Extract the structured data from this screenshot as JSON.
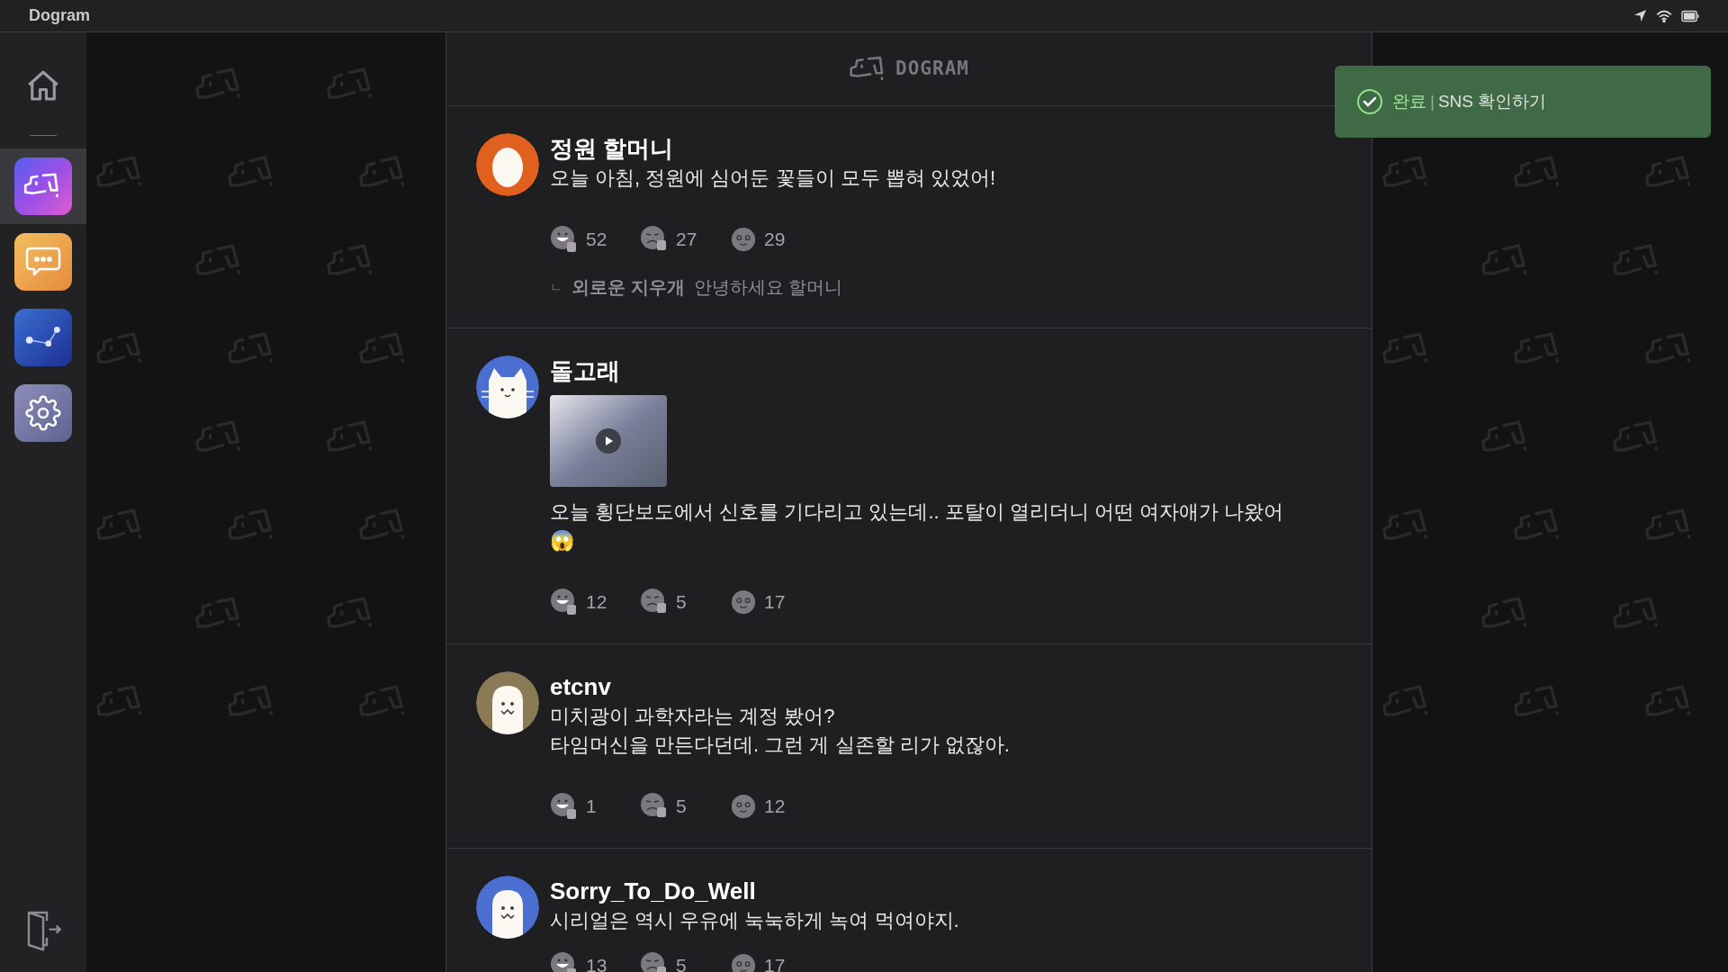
{
  "app_bar": {
    "title": "Dogram"
  },
  "sidebar": {
    "items": [
      {
        "kind": "home",
        "selected": false
      },
      {
        "kind": "dog",
        "selected": true
      },
      {
        "kind": "chat",
        "selected": false
      },
      {
        "kind": "graph",
        "selected": false
      },
      {
        "kind": "settings",
        "selected": false
      }
    ]
  },
  "feed": {
    "header": {
      "logo_text": "DOGRAM"
    },
    "posts": [
      {
        "author": "정원 할머니",
        "avatar": {
          "kind": "egg",
          "color": "#e0601f"
        },
        "text": [
          "오늘 아침, 정원에 심어둔 꽃들이 모두 뽑혀 있었어!"
        ],
        "video": false,
        "reactions": [
          {
            "kind": "like",
            "count": "52"
          },
          {
            "kind": "dislike",
            "count": "27"
          },
          {
            "kind": "wow",
            "count": "29"
          }
        ],
        "reply": {
          "marker": "ㄴ",
          "author": "외로운 지우개",
          "text": "안녕하세요 할머니"
        }
      },
      {
        "author": "돌고래",
        "avatar": {
          "kind": "cat",
          "color": "#4a6fd0"
        },
        "text": [
          "오늘 횡단보도에서 신호를 기다리고 있는데.. 포탈이 열리더니 어떤 여자애가 나왔어",
          "😱"
        ],
        "video": true,
        "reactions": [
          {
            "kind": "like",
            "count": "12"
          },
          {
            "kind": "dislike",
            "count": "5"
          },
          {
            "kind": "wow",
            "count": "17"
          }
        ]
      },
      {
        "author": "etcnv",
        "avatar": {
          "kind": "ghost",
          "color": "#8a7a55"
        },
        "text": [
          "미치광이 과학자라는 계정 봤어?",
          "타임머신을 만든다던데. 그런 게 실존할 리가 없잖아."
        ],
        "video": false,
        "reactions": [
          {
            "kind": "like",
            "count": "1"
          },
          {
            "kind": "dislike",
            "count": "5"
          },
          {
            "kind": "wow",
            "count": "12"
          }
        ]
      },
      {
        "author": "Sorry_To_Do_Well",
        "avatar": {
          "kind": "ghost",
          "color": "#4a6fd0"
        },
        "text": [
          "시리얼은 역시 우유에 눅눅하게 녹여 먹여야지."
        ],
        "video": false,
        "reactions": [
          {
            "kind": "like",
            "count": "13"
          },
          {
            "kind": "dislike",
            "count": "5"
          },
          {
            "kind": "wow",
            "count": "17"
          }
        ]
      }
    ]
  },
  "toast": {
    "status": "완료",
    "separator": "|",
    "message": "SNS 확인하기"
  }
}
